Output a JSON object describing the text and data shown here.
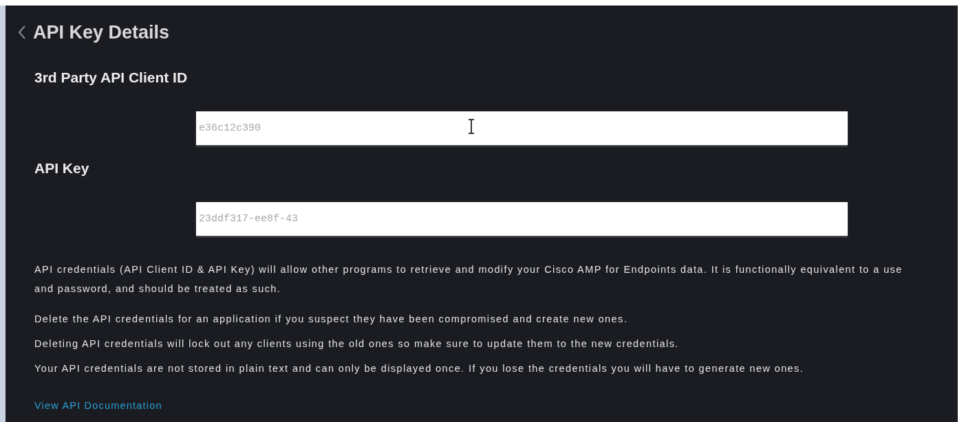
{
  "header": {
    "title": "API Key Details"
  },
  "fields": [
    {
      "label": "3rd Party API Client ID",
      "value": "e36c12c390"
    },
    {
      "label": "API Key",
      "value": "23ddf317-ee8f-43"
    }
  ],
  "notes": [
    {
      "lines": [
        "API credentials (API Client ID & API Key) will allow other programs to retrieve and modify your Cisco AMP for Endpoints data. It is functionally equivalent to a use",
        "and password, and should be treated as such."
      ]
    },
    {
      "lines": [
        "Delete the API credentials for an application if you suspect they have been compromised and create new ones."
      ]
    },
    {
      "lines": [
        "Deleting API credentials will lock out any clients using the old ones so make sure to update them to the new credentials."
      ]
    },
    {
      "lines": [
        "Your API credentials are not stored in plain text and can only be displayed once. If you lose the credentials you will have to generate new ones."
      ]
    }
  ],
  "link": "View API Documentation"
}
